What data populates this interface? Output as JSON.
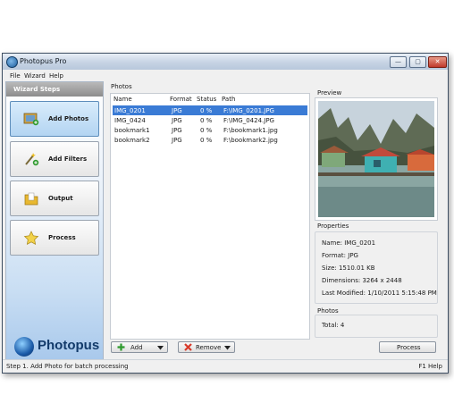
{
  "window": {
    "title": "Photopus Pro",
    "controls": {
      "minimize": "—",
      "maximize": "▢",
      "close": "✕"
    }
  },
  "menu": {
    "items": [
      "File",
      "Wizard",
      "Help"
    ]
  },
  "sidebar": {
    "header": "Wizard Steps",
    "steps": [
      {
        "label": "Add Photos",
        "icon": "add-photos-icon",
        "active": true
      },
      {
        "label": "Add Filters",
        "icon": "add-filters-icon",
        "active": false
      },
      {
        "label": "Output",
        "icon": "output-folder-icon",
        "active": false
      },
      {
        "label": "Process",
        "icon": "process-star-icon",
        "active": false
      }
    ],
    "logo_text": "Photopus"
  },
  "photos": {
    "caption": "Photos",
    "columns": [
      "Name",
      "Format",
      "Status",
      "Path"
    ],
    "rows": [
      {
        "name": "IMG_0201",
        "format": "JPG",
        "status": "0 %",
        "path": "F:\\IMG_0201.JPG",
        "selected": true
      },
      {
        "name": "IMG_0424",
        "format": "JPG",
        "status": "0 %",
        "path": "F:\\IMG_0424.JPG",
        "selected": false
      },
      {
        "name": "bookmark1",
        "format": "JPG",
        "status": "0 %",
        "path": "F:\\bookmark1.jpg",
        "selected": false
      },
      {
        "name": "bookmark2",
        "format": "JPG",
        "status": "0 %",
        "path": "F:\\bookmark2.jpg",
        "selected": false
      }
    ]
  },
  "preview": {
    "caption": "Preview"
  },
  "properties": {
    "caption": "Properties",
    "name": "Name: IMG_0201",
    "format": "Format: JPG",
    "size": "Size: 1510.01 KB",
    "dimensions": "Dimensions: 3264 x 2448",
    "modified": "Last Modified: 1/10/2011 5:15:48 PM"
  },
  "photos_summary": {
    "caption": "Photos",
    "total": "Total: 4"
  },
  "buttons": {
    "add": "Add",
    "remove": "Remove",
    "process": "Process"
  },
  "status": {
    "left": "Step 1. Add Photo for batch processing",
    "right": "F1 Help"
  },
  "colors": {
    "selection": "#3a7bd5",
    "accent": "#1a5aa8"
  }
}
